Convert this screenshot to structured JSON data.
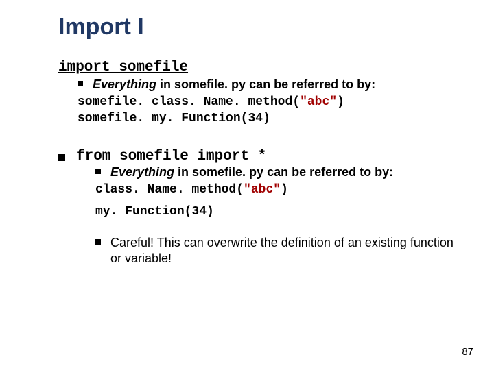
{
  "title": "Import I",
  "section1": {
    "import_stmt": "import somefile",
    "bullet_prefix_em": "Everything",
    "bullet_rest": " in somefile. py can be referred to by:",
    "code1a": "somefile. class. Name. method(",
    "code1a_q": "\"abc\"",
    "code1a_end": ")",
    "code1b": "somefile. my. Function(34)"
  },
  "section2": {
    "from_stmt": "from somefile import *",
    "bullet_prefix_em": "Everything",
    "bullet_rest": " in somefile. py can be referred to by:",
    "code2a": "class. Name. method(",
    "code2a_q": "\"abc\"",
    "code2a_end": ")",
    "code2b": "my. Function(34)",
    "warn": "Careful!  This can overwrite the definition of an existing function or variable!"
  },
  "page_number": "87"
}
